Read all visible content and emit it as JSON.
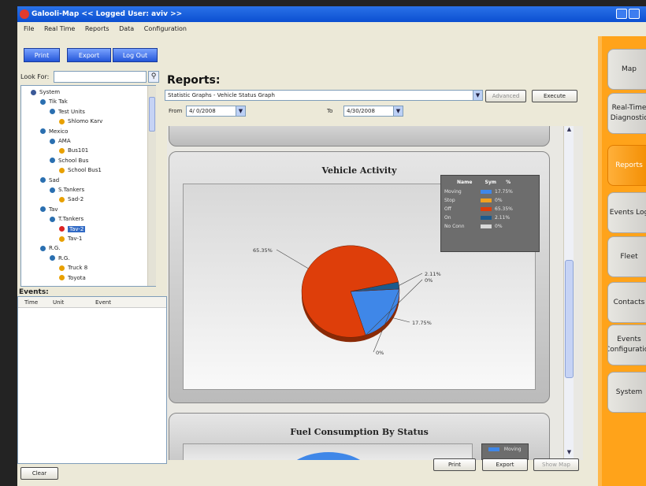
{
  "window": {
    "title": "Galooli-Map  << Logged User: aviv >>"
  },
  "menu": [
    "File",
    "Real Time",
    "Reports",
    "Data",
    "Configuration"
  ],
  "toolbar": {
    "print": "Print",
    "export": "Export",
    "logout": "Log Out"
  },
  "search": {
    "label": "Look For:",
    "value": ""
  },
  "tree": [
    {
      "label": "System",
      "level": 0,
      "icon": "server-icon",
      "color": "#3b5998"
    },
    {
      "label": "Tik Tak",
      "level": 1,
      "icon": "group-icon",
      "color": "#2a6fb0"
    },
    {
      "label": "Test Units",
      "level": 2,
      "icon": "group-icon",
      "color": "#2a6fb0"
    },
    {
      "label": "Shlomo Karv",
      "level": 3,
      "icon": "vehicle-icon",
      "color": "#e8a000"
    },
    {
      "label": "Mexico",
      "level": 1,
      "icon": "group-icon",
      "color": "#2a6fb0"
    },
    {
      "label": "AMA",
      "level": 2,
      "icon": "group-icon",
      "color": "#2a6fb0"
    },
    {
      "label": "Bus101",
      "level": 3,
      "icon": "vehicle-icon",
      "color": "#e8a000"
    },
    {
      "label": "School Bus",
      "level": 2,
      "icon": "group-icon",
      "color": "#2a6fb0"
    },
    {
      "label": "School Bus1",
      "level": 3,
      "icon": "vehicle-icon",
      "color": "#e8a000"
    },
    {
      "label": "Sad",
      "level": 1,
      "icon": "group-icon",
      "color": "#2a6fb0"
    },
    {
      "label": "S.Tankers",
      "level": 2,
      "icon": "group-icon",
      "color": "#2a6fb0"
    },
    {
      "label": "Sad-2",
      "level": 3,
      "icon": "vehicle-icon",
      "color": "#e8a000"
    },
    {
      "label": "Tav",
      "level": 1,
      "icon": "group-icon",
      "color": "#2a6fb0"
    },
    {
      "label": "T.Tankers",
      "level": 2,
      "icon": "group-icon",
      "color": "#2a6fb0"
    },
    {
      "label": "Tav-2",
      "level": 3,
      "icon": "vehicle-checked-icon",
      "color": "#d22",
      "selected": true
    },
    {
      "label": "Tav-1",
      "level": 3,
      "icon": "vehicle-icon",
      "color": "#e8a000"
    },
    {
      "label": "R.G.",
      "level": 1,
      "icon": "group-icon",
      "color": "#2a6fb0"
    },
    {
      "label": "R.G.",
      "level": 2,
      "icon": "group-icon",
      "color": "#2a6fb0"
    },
    {
      "label": "Truck 8",
      "level": 3,
      "icon": "vehicle-icon",
      "color": "#e8a000"
    },
    {
      "label": "Toyota",
      "level": 3,
      "icon": "vehicle-icon",
      "color": "#e8a000"
    }
  ],
  "events": {
    "title": "Events:",
    "columns": [
      "Time",
      "Unit",
      "Event"
    ],
    "clear": "Clear"
  },
  "reports": {
    "title": "Reports:",
    "selected_report": "Statistic Graphs - Vehicle Status Graph",
    "advanced": "Advanced",
    "execute": "Execute",
    "from_label": "From",
    "from_value": "4/ 0/2008",
    "to_label": "To",
    "to_value": "4/30/2008",
    "print": "Print",
    "export": "Export",
    "show_map": "Show Map"
  },
  "chart1": {
    "title": "Vehicle Activity",
    "legend_headers": [
      "Name",
      "Sym",
      "%"
    ]
  },
  "chart2": {
    "title": "Fuel Consumption By Status",
    "legend_first": "Moving"
  },
  "chart_data": [
    {
      "type": "pie",
      "title": "Vehicle Activity",
      "categories": [
        "Moving",
        "Stop",
        "Off",
        "On",
        "No Conn"
      ],
      "values": [
        17.75,
        0,
        65.35,
        2.11,
        0
      ],
      "labels": [
        "17.75%",
        "0%",
        "65.35%",
        "2.11%",
        "0%"
      ],
      "colors": [
        "#3f87e8",
        "#f0a020",
        "#de3e0a",
        "#1c5a8c",
        "#d8d8d8"
      ],
      "legend": "top-right"
    },
    {
      "type": "pie",
      "title": "Fuel Consumption By Status",
      "categories": [
        "Moving"
      ],
      "legend": "top-right"
    }
  ],
  "tabs": [
    {
      "label": "Map"
    },
    {
      "label": "Real-Time Diagnostic"
    },
    {
      "label": "Reports",
      "active": true
    },
    {
      "label": "Events Log"
    },
    {
      "label": "Fleet"
    },
    {
      "label": "Contacts"
    },
    {
      "label": "Events Configuration"
    },
    {
      "label": "System"
    }
  ]
}
